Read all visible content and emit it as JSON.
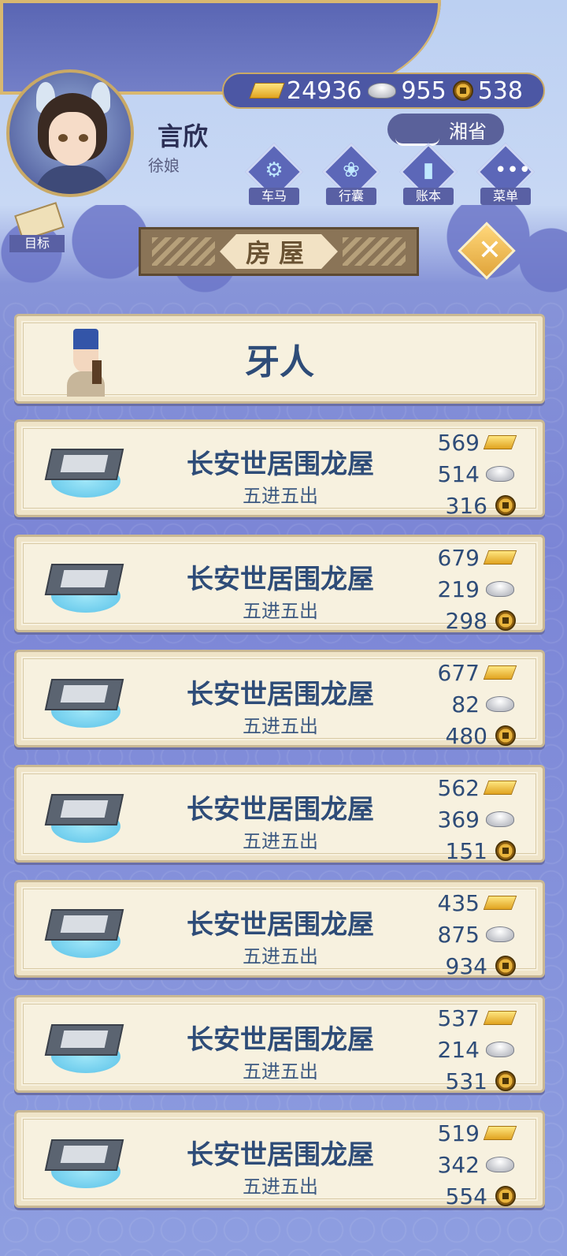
{
  "player": {
    "name": "言欣",
    "title": "徐娘"
  },
  "currency": {
    "gold": "24936",
    "silver": "955",
    "coins": "538"
  },
  "region": "湘省",
  "menu": [
    {
      "label": "车马",
      "icon": "carriage-icon"
    },
    {
      "label": "行囊",
      "icon": "bag-icon"
    },
    {
      "label": "账本",
      "icon": "ledger-icon"
    },
    {
      "label": "菜单",
      "icon": "more-icon"
    }
  ],
  "goal_label": "目标",
  "page_title": "房屋",
  "agent_label": "牙人",
  "houses": [
    {
      "name": "长安世居围龙屋",
      "layout": "五进五出",
      "gold": "569",
      "silver": "514",
      "coins": "316"
    },
    {
      "name": "长安世居围龙屋",
      "layout": "五进五出",
      "gold": "679",
      "silver": "219",
      "coins": "298"
    },
    {
      "name": "长安世居围龙屋",
      "layout": "五进五出",
      "gold": "677",
      "silver": "82",
      "coins": "480"
    },
    {
      "name": "长安世居围龙屋",
      "layout": "五进五出",
      "gold": "562",
      "silver": "369",
      "coins": "151"
    },
    {
      "name": "长安世居围龙屋",
      "layout": "五进五出",
      "gold": "435",
      "silver": "875",
      "coins": "934"
    },
    {
      "name": "长安世居围龙屋",
      "layout": "五进五出",
      "gold": "537",
      "silver": "214",
      "coins": "531"
    },
    {
      "name": "长安世居围龙屋",
      "layout": "五进五出",
      "gold": "519",
      "silver": "342",
      "coins": "554"
    }
  ]
}
